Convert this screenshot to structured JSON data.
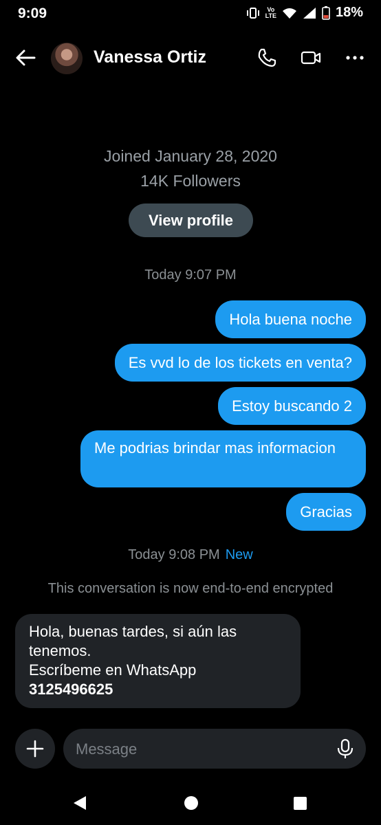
{
  "status_bar": {
    "time": "9:09",
    "network_top": "Vo",
    "network_bottom": "LTE",
    "battery": "18%"
  },
  "header": {
    "name": "Vanessa Ortiz",
    "icons": [
      "back-arrow-icon",
      "phone-icon",
      "video-call-icon",
      "more-options-icon"
    ]
  },
  "profile": {
    "joined": "Joined January 28, 2020",
    "followers": "14K Followers",
    "view_profile_label": "View profile"
  },
  "conversation": {
    "timestamp_1": "Today 9:07 PM",
    "sent_messages": [
      "Hola buena noche",
      "Es vvd lo de los tickets en venta?",
      "Estoy buscando 2",
      "Me podrias brindar mas informacion",
      "Gracias"
    ],
    "timestamp_2": "Today 9:08 PM",
    "new_label": "New",
    "encrypted_notice": "This conversation is now end-to-end encrypted",
    "received_message": {
      "line1": "Hola, buenas tardes, si aún las tenemos.",
      "line2": "Escríbeme en WhatsApp",
      "phone": "3125496625"
    }
  },
  "composer": {
    "placeholder": "Message",
    "icons": [
      "plus-icon",
      "microphone-icon"
    ]
  },
  "colors": {
    "accent": "#1d9bf0",
    "background": "#000000",
    "received_bubble": "#202327",
    "profile_button": "#3d4a52"
  }
}
